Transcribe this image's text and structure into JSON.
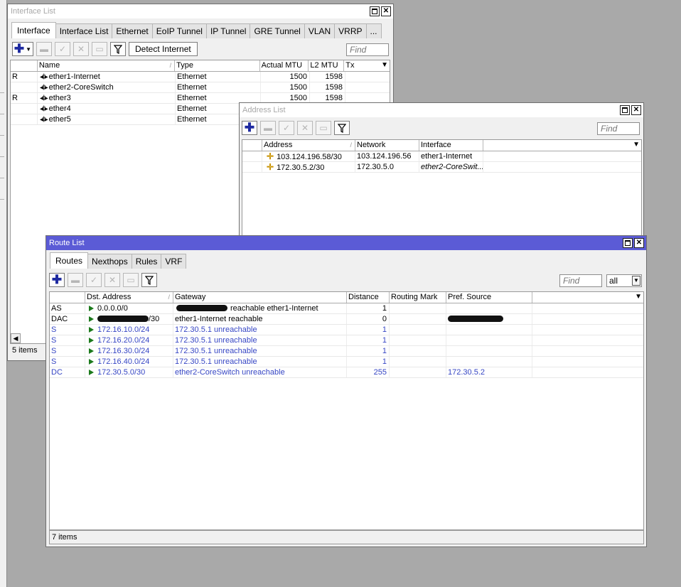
{
  "interface_window": {
    "title": "Interface List",
    "tabs": [
      "Interface",
      "Interface List",
      "Ethernet",
      "EoIP Tunnel",
      "IP Tunnel",
      "GRE Tunnel",
      "VLAN",
      "VRRP",
      "..."
    ],
    "detect_button": "Detect Internet",
    "find_placeholder": "Find",
    "columns": [
      "Name",
      "Type",
      "Actual MTU",
      "L2 MTU",
      "Tx"
    ],
    "rows": [
      {
        "flag": "R",
        "name": "ether1-Internet",
        "type": "Ethernet",
        "mtu": "1500",
        "l2mtu": "1598"
      },
      {
        "flag": "",
        "name": "ether2-CoreSwitch",
        "type": "Ethernet",
        "mtu": "1500",
        "l2mtu": "1598"
      },
      {
        "flag": "R",
        "name": "ether3",
        "type": "Ethernet",
        "mtu": "1500",
        "l2mtu": "1598"
      },
      {
        "flag": "",
        "name": "ether4",
        "type": "Ethernet",
        "mtu": "",
        "l2mtu": ""
      },
      {
        "flag": "",
        "name": "ether5",
        "type": "Ethernet",
        "mtu": "",
        "l2mtu": ""
      }
    ],
    "status": "5 items"
  },
  "address_window": {
    "title": "Address List",
    "find_placeholder": "Find",
    "columns": [
      "Address",
      "Network",
      "Interface"
    ],
    "rows": [
      {
        "address": "103.124.196.58/30",
        "network": "103.124.196.56",
        "interface": "ether1-Internet",
        "italic": false
      },
      {
        "address": "172.30.5.2/30",
        "network": "172.30.5.0",
        "interface": "ether2-CoreSwit...",
        "italic": true
      }
    ]
  },
  "route_window": {
    "title": "Route List",
    "tabs": [
      "Routes",
      "Nexthops",
      "Rules",
      "VRF"
    ],
    "find_placeholder": "Find",
    "filter_value": "all",
    "columns": [
      "Dst. Address",
      "Gateway",
      "Distance",
      "Routing Mark",
      "Pref. Source"
    ],
    "rows": [
      {
        "flags": "AS",
        "dst": "0.0.0.0/0",
        "gateway": "reachable ether1-Internet",
        "distance": "1",
        "mark": "",
        "pref": "",
        "blue": false
      },
      {
        "flags": "DAC",
        "dst": "/30",
        "gateway": "ether1-Internet reachable",
        "distance": "0",
        "mark": "",
        "pref": "",
        "blue": false
      },
      {
        "flags": "S",
        "dst": "172.16.10.0/24",
        "gateway": "172.30.5.1 unreachable",
        "distance": "1",
        "mark": "",
        "pref": "",
        "blue": true
      },
      {
        "flags": "S",
        "dst": "172.16.20.0/24",
        "gateway": "172.30.5.1 unreachable",
        "distance": "1",
        "mark": "",
        "pref": "",
        "blue": true
      },
      {
        "flags": "S",
        "dst": "172.16.30.0/24",
        "gateway": "172.30.5.1 unreachable",
        "distance": "1",
        "mark": "",
        "pref": "",
        "blue": true
      },
      {
        "flags": "S",
        "dst": "172.16.40.0/24",
        "gateway": "172.30.5.1 unreachable",
        "distance": "1",
        "mark": "",
        "pref": "",
        "blue": true
      },
      {
        "flags": "DC",
        "dst": "172.30.5.0/30",
        "gateway": "ether2-CoreSwitch unreachable",
        "distance": "255",
        "mark": "",
        "pref": "172.30.5.2",
        "blue": true
      }
    ],
    "status": "7 items"
  },
  "colors": {
    "active_title": "#5b5bd6",
    "unreachable_text": "#3646c4",
    "route_flag": "#1c7a1c"
  },
  "icons": [
    "maximize-icon",
    "close-icon",
    "add-icon",
    "remove-icon",
    "enable-icon",
    "disable-icon",
    "comment-icon",
    "filter-icon"
  ]
}
